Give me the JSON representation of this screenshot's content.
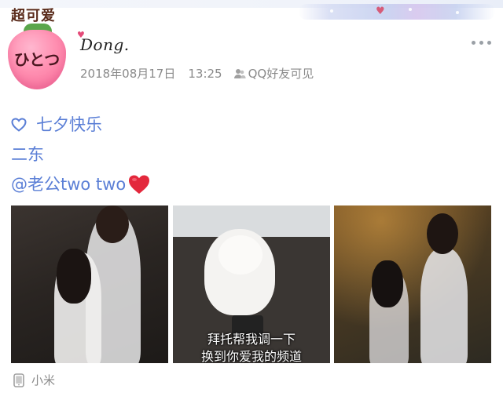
{
  "header": {
    "avatar_tagline": "超可爱",
    "avatar_word": "ひとつ",
    "username": "Dong.",
    "date": "2018年08月17日",
    "time": "13:25",
    "visibility": "QQ好友可见"
  },
  "post": {
    "lines": [
      "七夕快乐",
      "二东",
      "@老公two two"
    ]
  },
  "photos": {
    "caption_line1": "拜托帮我调一下",
    "caption_line2": "换到你爱我的频道"
  },
  "footer": {
    "device": "小米"
  },
  "colors": {
    "accent": "#5b7fd6",
    "meta": "#8a8a8a",
    "heart": "#e3283c"
  },
  "icons": [
    "heart-outline-icon",
    "red-heart-icon",
    "friends-icon",
    "phone-icon",
    "more-icon"
  ]
}
